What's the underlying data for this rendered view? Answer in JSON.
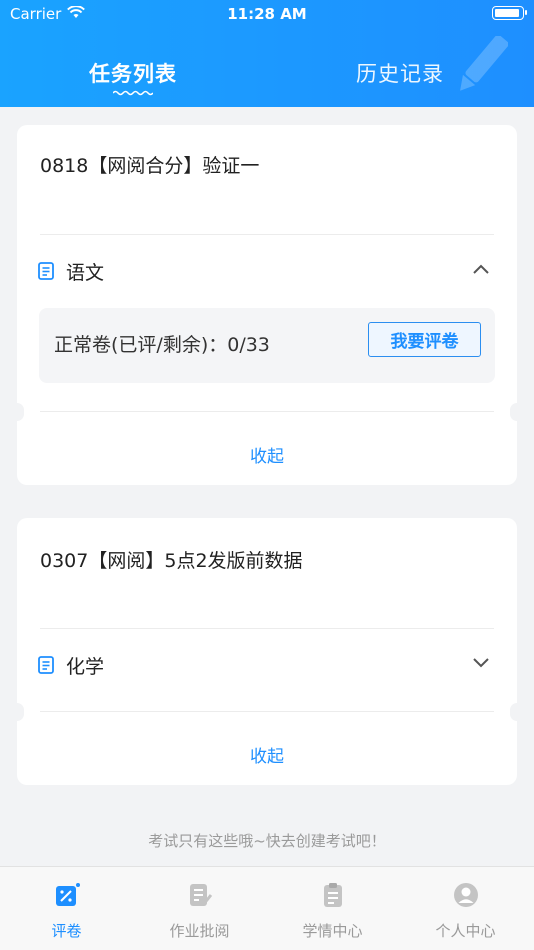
{
  "status_bar": {
    "carrier": "Carrier",
    "time": "11:28 AM"
  },
  "header": {
    "tabs": [
      {
        "label": "任务列表",
        "active": true
      },
      {
        "label": "历史记录",
        "active": false
      }
    ]
  },
  "cards": [
    {
      "title": "0818【网阅合分】验证一",
      "subject": "语文",
      "expanded": true,
      "papers": [
        {
          "label": "正常卷(已评/剩余)：0/33",
          "button": "我要评卷"
        }
      ],
      "collapse_label": "收起"
    },
    {
      "title": "0307【网阅】5点2发版前数据",
      "subject": "化学",
      "expanded": false,
      "collapse_label": "收起"
    }
  ],
  "hint": "考试只有这些哦~快去创建考试吧！",
  "tabbar": [
    {
      "label": "评卷",
      "icon": "grade-icon",
      "active": true
    },
    {
      "label": "作业批阅",
      "icon": "homework-icon",
      "active": false
    },
    {
      "label": "学情中心",
      "icon": "clipboard-icon",
      "active": false
    },
    {
      "label": "个人中心",
      "icon": "person-icon",
      "active": false
    }
  ],
  "colors": {
    "brand_blue": "#1e8fff",
    "background": "#f2f3f5",
    "hint_gray": "#9a9a9a"
  }
}
